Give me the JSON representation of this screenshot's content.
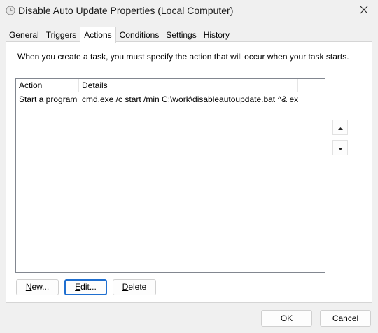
{
  "window": {
    "title": "Disable Auto Update Properties (Local Computer)",
    "title_icon": "clock-icon",
    "close_icon": "close-icon"
  },
  "tabs": [
    {
      "label": "General",
      "active": false
    },
    {
      "label": "Triggers",
      "active": false
    },
    {
      "label": "Actions",
      "active": true
    },
    {
      "label": "Conditions",
      "active": false
    },
    {
      "label": "Settings",
      "active": false
    },
    {
      "label": "History",
      "active": false
    }
  ],
  "actions_tab": {
    "instruction": "When you create a task, you must specify the action that will occur when your task starts.",
    "columns": [
      "Action",
      "Details"
    ],
    "rows": [
      {
        "action": "Start a program",
        "details": "cmd.exe /c start /min C:\\work\\disableautoupdate.bat ^& exit"
      }
    ],
    "move_up_icon": "arrow-up-icon",
    "move_down_icon": "arrow-down-icon",
    "buttons": {
      "new": {
        "prefix": "",
        "accel": "N",
        "suffix": "ew..."
      },
      "edit": {
        "prefix": "",
        "accel": "E",
        "suffix": "dit..."
      },
      "delete": {
        "prefix": "",
        "accel": "D",
        "suffix": "elete"
      }
    }
  },
  "footer": {
    "ok_label": "OK",
    "cancel_label": "Cancel"
  },
  "colors": {
    "focus_border": "#1f6fd0",
    "window_bg": "#f0f0f0",
    "panel_bg": "#ffffff"
  }
}
